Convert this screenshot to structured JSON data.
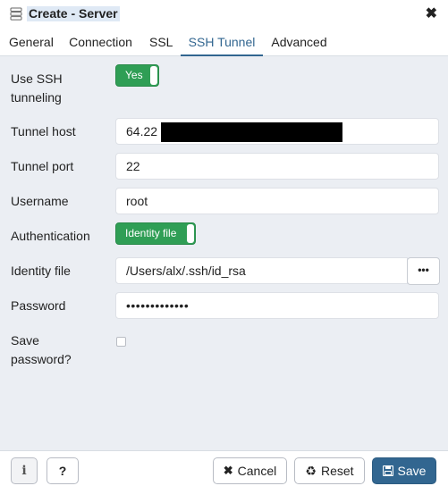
{
  "window": {
    "title": "Create - Server",
    "close_glyph": "✖"
  },
  "tabs": [
    {
      "label": "General"
    },
    {
      "label": "Connection"
    },
    {
      "label": "SSL"
    },
    {
      "label": "SSH Tunnel",
      "active": true
    },
    {
      "label": "Advanced"
    }
  ],
  "form": {
    "use_ssh": {
      "label": "Use SSH tunneling",
      "label_line1": "Use SSH",
      "label_line2": "tunneling",
      "value": "Yes"
    },
    "tunnel_host": {
      "label": "Tunnel host",
      "value": "64.22"
    },
    "tunnel_port": {
      "label": "Tunnel port",
      "value": "22"
    },
    "username": {
      "label": "Username",
      "value": "root"
    },
    "authentication": {
      "label": "Authentication",
      "value": "Identity file"
    },
    "identity_file": {
      "label": "Identity file",
      "value": "/Users/alx/.ssh/id_rsa",
      "browse_label": "•••"
    },
    "password": {
      "label": "Password",
      "value": "•••••••••••••"
    },
    "save_password": {
      "label": "Save password?",
      "label_line1": "Save",
      "label_line2": "password?",
      "checked": false
    }
  },
  "footer": {
    "info_label": "i",
    "help_label": "?",
    "cancel_label": "Cancel",
    "reset_label": "Reset",
    "save_label": "Save"
  },
  "colors": {
    "accent": "#326690",
    "toggle_on": "#2f9e55",
    "panel_bg": "#ebeef3"
  },
  "icons": {
    "title": "server-icon",
    "close": "close-icon",
    "cancel": "x-icon",
    "reset": "recycle-icon",
    "save": "floppy-disk-icon"
  }
}
